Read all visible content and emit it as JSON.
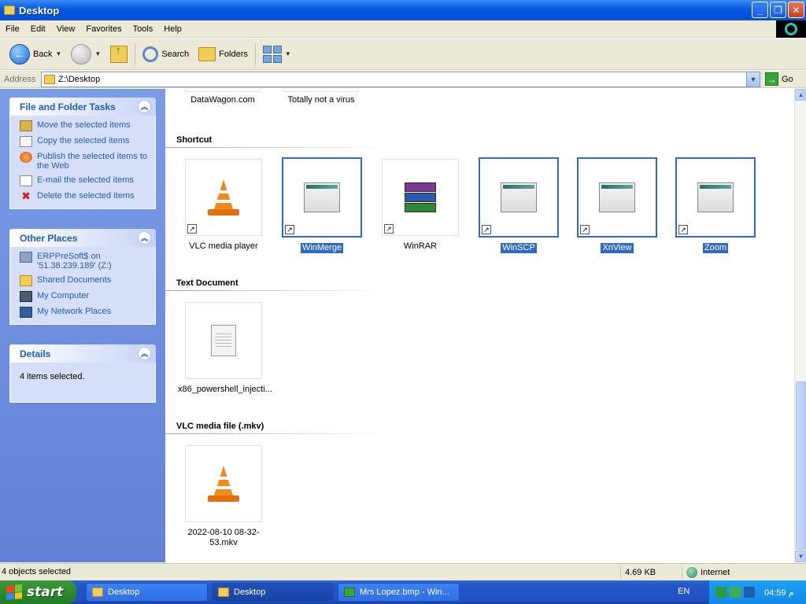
{
  "window": {
    "title": "Desktop",
    "minimize": "_",
    "maximize": "❐",
    "close": "✕"
  },
  "menu": [
    "File",
    "Edit",
    "View",
    "Favorites",
    "Tools",
    "Help"
  ],
  "toolbar": {
    "back": "Back",
    "search": "Search",
    "folders": "Folders"
  },
  "address": {
    "label": "Address",
    "value": "Z:\\Desktop",
    "go": "Go"
  },
  "tasks": {
    "file_folder": {
      "title": "File and Folder Tasks",
      "items": [
        "Move the selected items",
        "Copy the selected items",
        "Publish the selected items to the Web",
        "E-mail the selected items",
        "Delete the selected items"
      ]
    },
    "other_places": {
      "title": "Other Places",
      "items": [
        "ERPPreSoft$ on '51.38.239.189' (Z:)",
        "Shared Documents",
        "My Computer",
        "My Network Places"
      ]
    },
    "details": {
      "title": "Details",
      "text": "4 items selected."
    }
  },
  "content": {
    "partial_items": [
      "DataWagon.com",
      "Totally not a virus"
    ],
    "groups": {
      "shortcut": {
        "title": "Shortcut",
        "items": [
          {
            "label": "VLC media player",
            "selected": false
          },
          {
            "label": "WinMerge",
            "selected": true
          },
          {
            "label": "WinRAR",
            "selected": false
          },
          {
            "label": "WinSCP",
            "selected": true
          },
          {
            "label": "XnView",
            "selected": true
          },
          {
            "label": "Zoom",
            "selected": true
          }
        ]
      },
      "text_document": {
        "title": "Text Document",
        "items": [
          {
            "label": "x86_powershell_injecti..."
          }
        ]
      },
      "vlc_file": {
        "title": "VLC media file (.mkv)",
        "items": [
          {
            "label": "2022-08-10 08-32-53.mkv"
          }
        ]
      }
    }
  },
  "status": {
    "left": "4 objects selected",
    "size": "4.69 KB",
    "zone": "Internet"
  },
  "taskbar": {
    "start": "start",
    "tasks": [
      "Desktop",
      "Desktop",
      "Mrs Lopez.bmp - Win..."
    ],
    "lang": "EN",
    "clock": "04:59 م"
  }
}
